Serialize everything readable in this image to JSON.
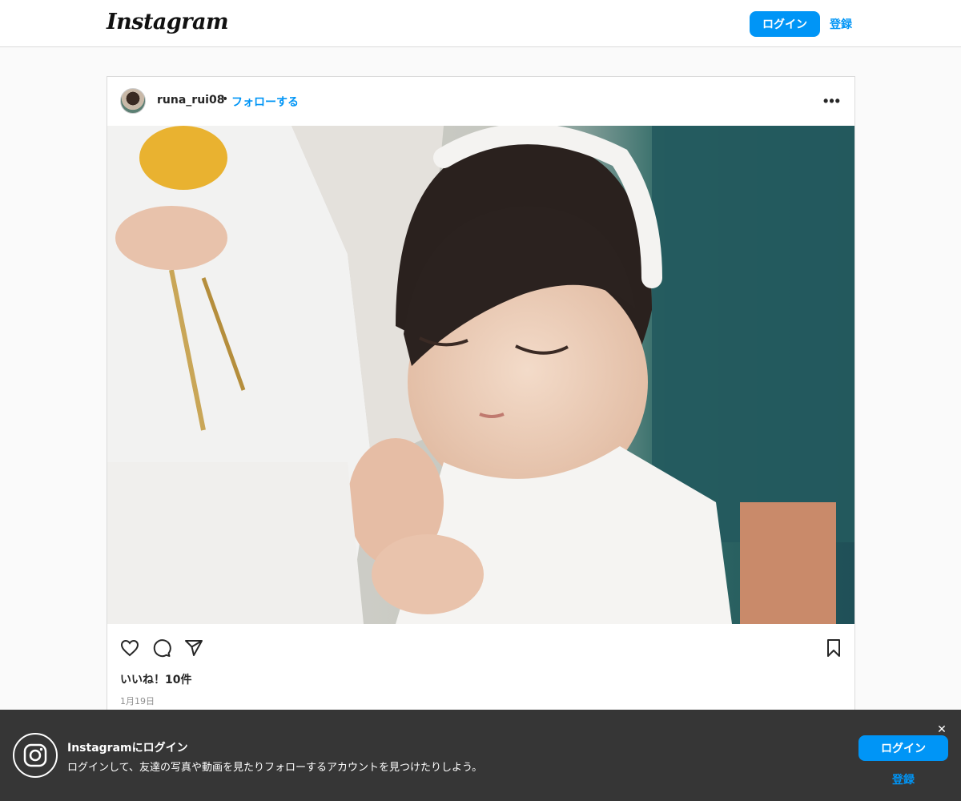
{
  "header": {
    "logo_text": "Instagram",
    "login_label": "ログイン",
    "signup_label": "登録"
  },
  "post": {
    "username": "runa_rui08",
    "separator": "•",
    "follow_label": "フォローする",
    "more_label": "•••",
    "likes_text": "いいね！10件",
    "date_text": "1月19日"
  },
  "banner": {
    "title": "Instagramにログイン",
    "subtitle": "ログインして、友達の写真や動画を見たりフォローするアカウントを見つけたりしよう。",
    "close_label": "✕",
    "login_label": "ログイン",
    "signup_label": "登録"
  },
  "icons": [
    "heart-icon",
    "comment-icon",
    "share-icon",
    "bookmark-icon",
    "instagram-icon",
    "more-options-icon",
    "close-icon"
  ],
  "colors": {
    "accent": "#0095f6",
    "banner_bg": "#363636",
    "border": "#dbdbdb"
  }
}
